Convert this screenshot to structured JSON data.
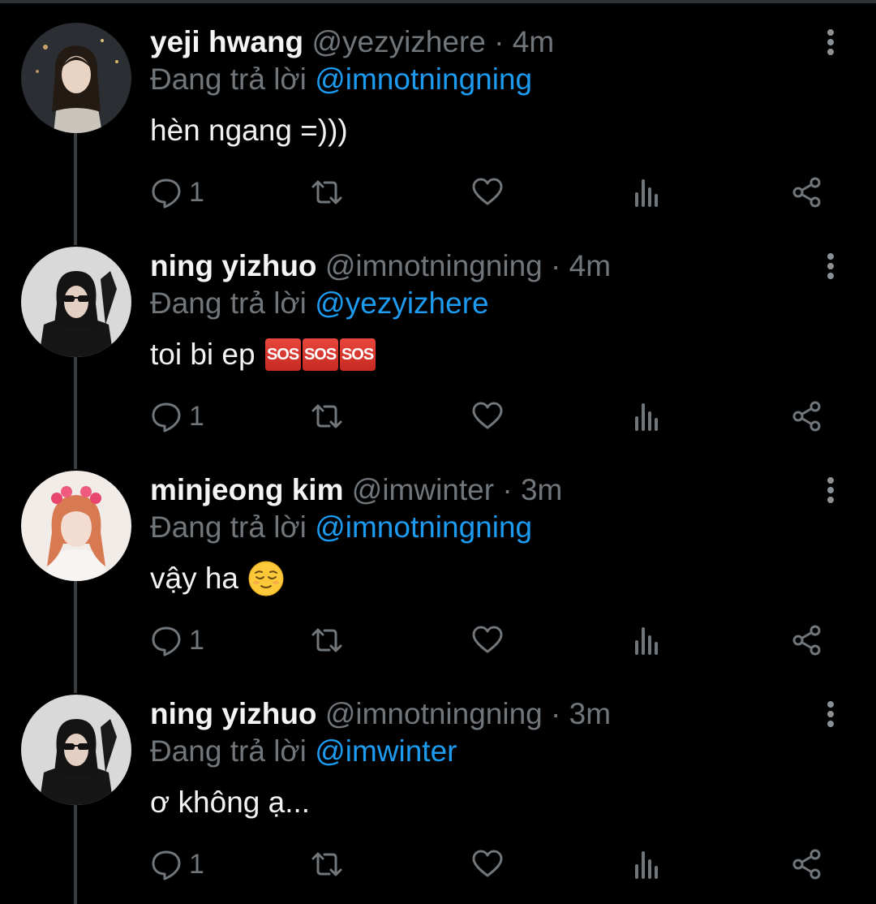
{
  "tweets": [
    {
      "name": "yeji hwang",
      "handle": "@yezyizhere",
      "dot": "·",
      "time": "4m",
      "reply_prefix": "Đang trả lời",
      "reply_to": "@imnotningning",
      "text": "hèn ngang =)))",
      "reply_count": "1",
      "avatar_icon": "avatar-photo-yeji"
    },
    {
      "name": "ning yizhuo",
      "handle": "@imnotningning",
      "dot": "·",
      "time": "4m",
      "reply_prefix": "Đang trả lời",
      "reply_to": "@yezyizhere",
      "text": "toi bi ep",
      "emoji": "sos-button-emoji",
      "emoji_label": "SOS",
      "reply_count": "1",
      "avatar_icon": "avatar-photo-ning"
    },
    {
      "name": "minjeong kim",
      "handle": "@imwinter",
      "dot": "·",
      "time": "3m",
      "reply_prefix": "Đang trả lời",
      "reply_to": "@imnotningning",
      "text": "vậy ha",
      "emoji": "relieved-face-emoji",
      "reply_count": "1",
      "avatar_icon": "avatar-photo-minjeong"
    },
    {
      "name": "ning yizhuo",
      "handle": "@imnotningning",
      "dot": "·",
      "time": "3m",
      "reply_prefix": "Đang trả lời",
      "reply_to": "@imwinter",
      "text": "ơ không ạ...",
      "reply_count": "1",
      "avatar_icon": "avatar-photo-ning"
    }
  ],
  "icons": [
    "reply-icon",
    "retweet-icon",
    "like-icon",
    "views-icon",
    "share-icon",
    "more-icon"
  ],
  "colors": {
    "background": "#000000",
    "muted": "#71767b",
    "mention": "#1d9bf0",
    "text": "#e7e9ea"
  }
}
